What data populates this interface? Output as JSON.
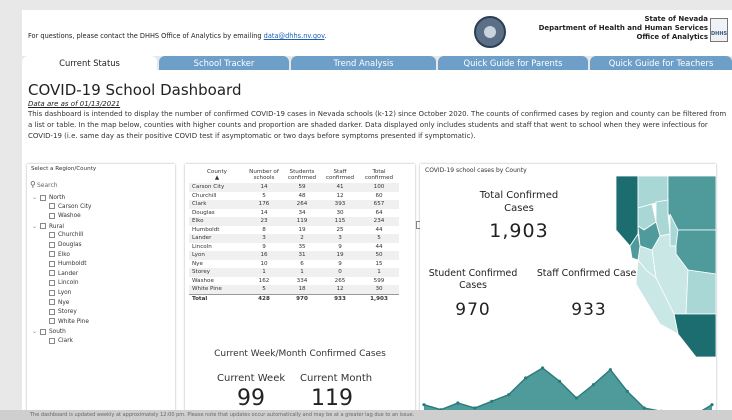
{
  "header": {
    "contact_prefix": "For questions, please contact the DHHS Office of Analytics by emailing ",
    "contact_email": "data@dhhs.nv.gov",
    "contact_suffix": ".",
    "agency_line1": "State of Nevada",
    "agency_line2": "Department of Health and Human Services",
    "agency_line3": "Office of Analytics",
    "logo_text": "DHHS"
  },
  "tabs": [
    {
      "label": "Current Status",
      "active": true
    },
    {
      "label": "School Tracker",
      "active": false
    },
    {
      "label": "Trend Analysis",
      "active": false
    },
    {
      "label": "Quick Guide for Parents",
      "active": false
    },
    {
      "label": "Quick Guide for Teachers",
      "active": false
    }
  ],
  "main": {
    "title": "COVID-19 School Dashboard",
    "as_of": "Data are as of 01/13/2021",
    "description": "This dashboard is intended to display the number of confirmed COVID-19 cases in Nevada schools (k-12) since October 2020. The counts of confirmed cases by region and county can be filtered from a list or table. In the map below, counties with higher counts and proportion are shaded darker. Data displayed only includes students and staff that went to school when they were infectious for COVID-19 (i.e. same day as their positive COVID test if asymptomatic or two days before symptoms presented if symptomatic)."
  },
  "region_filter": {
    "title": "Select a Region/County",
    "search_placeholder": "Search",
    "items": [
      {
        "label": "North",
        "level": 0
      },
      {
        "label": "Carson City",
        "level": 1
      },
      {
        "label": "Washoe",
        "level": 1
      },
      {
        "label": "Rural",
        "level": 0
      },
      {
        "label": "Churchill",
        "level": 1
      },
      {
        "label": "Douglas",
        "level": 1
      },
      {
        "label": "Elko",
        "level": 1
      },
      {
        "label": "Humboldt",
        "level": 1
      },
      {
        "label": "Lander",
        "level": 1
      },
      {
        "label": "Lincoln",
        "level": 1
      },
      {
        "label": "Lyon",
        "level": 1
      },
      {
        "label": "Nye",
        "level": 1
      },
      {
        "label": "Storey",
        "level": 1
      },
      {
        "label": "White Pine",
        "level": 1
      },
      {
        "label": "South",
        "level": 0
      },
      {
        "label": "Clark",
        "level": 1
      }
    ]
  },
  "table": {
    "headers": [
      "County",
      "Number of schools",
      "Students confirmed",
      "Staff confirmed",
      "Total confirmed"
    ],
    "rows": [
      [
        "Carson City",
        "14",
        "59",
        "41",
        "100"
      ],
      [
        "Churchill",
        "5",
        "48",
        "12",
        "60"
      ],
      [
        "Clark",
        "176",
        "264",
        "393",
        "657"
      ],
      [
        "Douglas",
        "14",
        "34",
        "30",
        "64"
      ],
      [
        "Elko",
        "23",
        "119",
        "115",
        "234"
      ],
      [
        "Humboldt",
        "8",
        "19",
        "25",
        "44"
      ],
      [
        "Lander",
        "3",
        "2",
        "3",
        "5"
      ],
      [
        "Lincoln",
        "9",
        "35",
        "9",
        "44"
      ],
      [
        "Lyon",
        "16",
        "31",
        "19",
        "50"
      ],
      [
        "Nye",
        "10",
        "6",
        "9",
        "15"
      ],
      [
        "Storey",
        "1",
        "1",
        "0",
        "1"
      ],
      [
        "Washoe",
        "162",
        "334",
        "265",
        "599"
      ],
      [
        "White Pine",
        "5",
        "18",
        "12",
        "30"
      ]
    ],
    "total": [
      "Total",
      "428",
      "970",
      "933",
      "1,903"
    ]
  },
  "current_cases": {
    "title": "Current Week/Month Confirmed Cases",
    "week_label": "Current Week",
    "week_value": "99",
    "month_label": "Current Month",
    "month_value": "119"
  },
  "summary": {
    "title": "COVID-19 school cases by County",
    "total_label": "Total Confirmed Cases",
    "total_value": "1,903",
    "student_label": "Student Confirmed Cases",
    "student_value": "970",
    "staff_label": "Staff Confirmed Cases",
    "staff_value": "933"
  },
  "trend": {
    "values": [
      8,
      5,
      9,
      6,
      10,
      14,
      24,
      30,
      22,
      12,
      20,
      29,
      16,
      6,
      4,
      1,
      2,
      8
    ],
    "highlight_index": 16,
    "colors": {
      "fill": "#4f9a9a",
      "line": "#2b7b7c",
      "highlight": "#e8493a"
    }
  },
  "map_colors": {
    "dark": "#1c6d70",
    "mid": "#4f9a9a",
    "light": "#a9d7d6",
    "lightest": "#c8e7e5"
  },
  "footer": {
    "text": "The dashboard is updated weekly at approximately 12:00 pm. Please note that updates occur automatically and may be at a greater lag due to an issue."
  }
}
